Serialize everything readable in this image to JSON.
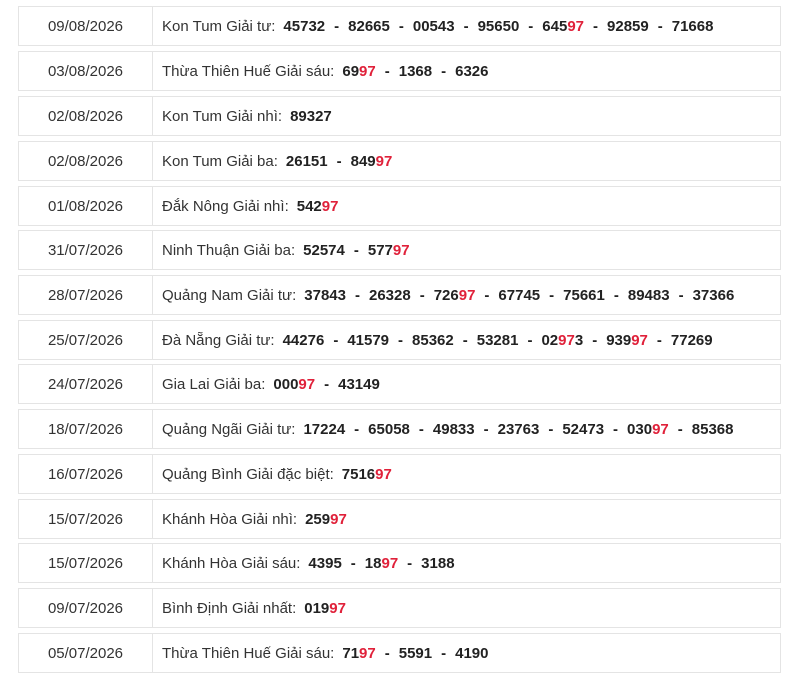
{
  "colors": {
    "highlight": "#e0213a",
    "border": "#e4e4e4",
    "text": "#333333"
  },
  "rows": [
    {
      "date": "09/08/2026",
      "label": "Kon Tum Giải tư:",
      "numbers": [
        {
          "pre": "45732",
          "hl": ""
        },
        {
          "pre": "82665",
          "hl": ""
        },
        {
          "pre": "00543",
          "hl": ""
        },
        {
          "pre": "95650",
          "hl": ""
        },
        {
          "pre": "645",
          "hl": "97"
        },
        {
          "pre": "92859",
          "hl": ""
        },
        {
          "pre": "71668",
          "hl": ""
        }
      ]
    },
    {
      "date": "03/08/2026",
      "label": "Thừa Thiên Huế Giải sáu:",
      "numbers": [
        {
          "pre": "69",
          "hl": "97"
        },
        {
          "pre": "1368",
          "hl": ""
        },
        {
          "pre": "6326",
          "hl": ""
        }
      ]
    },
    {
      "date": "02/08/2026",
      "label": "Kon Tum Giải nhì:",
      "numbers": [
        {
          "pre": "89327",
          "hl": ""
        }
      ]
    },
    {
      "date": "02/08/2026",
      "label": "Kon Tum Giải ba:",
      "numbers": [
        {
          "pre": "26151",
          "hl": ""
        },
        {
          "pre": "849",
          "hl": "97"
        }
      ]
    },
    {
      "date": "01/08/2026",
      "label": "Đắk Nông Giải nhì:",
      "numbers": [
        {
          "pre": "542",
          "hl": "97"
        }
      ]
    },
    {
      "date": "31/07/2026",
      "label": "Ninh Thuận Giải ba:",
      "numbers": [
        {
          "pre": "52574",
          "hl": ""
        },
        {
          "pre": "577",
          "hl": "97"
        }
      ]
    },
    {
      "date": "28/07/2026",
      "label": "Quảng Nam Giải tư:",
      "numbers": [
        {
          "pre": "37843",
          "hl": ""
        },
        {
          "pre": "26328",
          "hl": ""
        },
        {
          "pre": "726",
          "hl": "97"
        },
        {
          "pre": "67745",
          "hl": ""
        },
        {
          "pre": "75661",
          "hl": ""
        },
        {
          "pre": "89483",
          "hl": ""
        },
        {
          "pre": "37366",
          "hl": ""
        }
      ]
    },
    {
      "date": "25/07/2026",
      "label": "Đà Nẵng Giải tư:",
      "numbers": [
        {
          "pre": "44276",
          "hl": ""
        },
        {
          "pre": "41579",
          "hl": ""
        },
        {
          "pre": "85362",
          "hl": ""
        },
        {
          "pre": "53281",
          "hl": ""
        },
        {
          "pre": "02",
          "hl": "97",
          "post": "3"
        },
        {
          "pre": "939",
          "hl": "97"
        },
        {
          "pre": "77269",
          "hl": ""
        }
      ]
    },
    {
      "date": "24/07/2026",
      "label": "Gia Lai Giải ba:",
      "numbers": [
        {
          "pre": "000",
          "hl": "97"
        },
        {
          "pre": "43149",
          "hl": ""
        }
      ]
    },
    {
      "date": "18/07/2026",
      "label": "Quảng Ngãi Giải tư:",
      "numbers": [
        {
          "pre": "17224",
          "hl": ""
        },
        {
          "pre": "65058",
          "hl": ""
        },
        {
          "pre": "49833",
          "hl": ""
        },
        {
          "pre": "23763",
          "hl": ""
        },
        {
          "pre": "52473",
          "hl": ""
        },
        {
          "pre": "030",
          "hl": "97"
        },
        {
          "pre": "85368",
          "hl": ""
        }
      ]
    },
    {
      "date": "16/07/2026",
      "label": "Quảng Bình Giải đặc biệt:",
      "numbers": [
        {
          "pre": "7516",
          "hl": "97"
        }
      ]
    },
    {
      "date": "15/07/2026",
      "label": "Khánh Hòa Giải nhì:",
      "numbers": [
        {
          "pre": "259",
          "hl": "97"
        }
      ]
    },
    {
      "date": "15/07/2026",
      "label": "Khánh Hòa Giải sáu:",
      "numbers": [
        {
          "pre": "4395",
          "hl": ""
        },
        {
          "pre": "18",
          "hl": "97"
        },
        {
          "pre": "3188",
          "hl": ""
        }
      ]
    },
    {
      "date": "09/07/2026",
      "label": "Bình Định Giải nhất:",
      "numbers": [
        {
          "pre": "019",
          "hl": "97"
        }
      ]
    },
    {
      "date": "05/07/2026",
      "label": "Thừa Thiên Huế Giải sáu:",
      "numbers": [
        {
          "pre": "71",
          "hl": "97"
        },
        {
          "pre": "5591",
          "hl": ""
        },
        {
          "pre": "4190",
          "hl": ""
        }
      ]
    }
  ]
}
